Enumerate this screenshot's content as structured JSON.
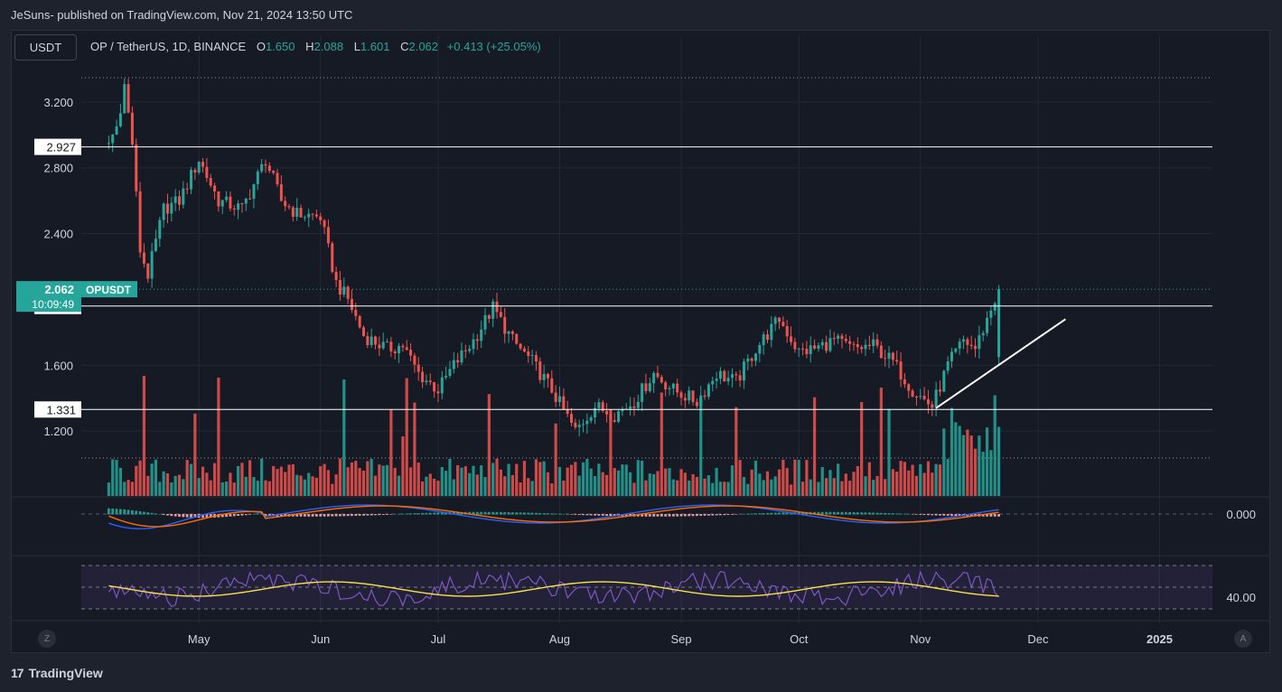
{
  "header": {
    "published": "JeSuns- published on TradingView.com, Nov 21, 2024 13:50 UTC"
  },
  "currency_button": "USDT",
  "legend": {
    "symbol": "OP / TetherUS, 1D, BINANCE",
    "o_label": "O",
    "o_value": "1.650",
    "h_label": "H",
    "h_value": "2.088",
    "l_label": "L",
    "l_value": "1.601",
    "c_label": "C",
    "c_value": "2.062",
    "change": "+0.413 (+25.05%)"
  },
  "price_scale": {
    "ticks": [
      "3.200",
      "2.800",
      "2.400",
      "1.600",
      "1.200"
    ],
    "tick_values": [
      3.2,
      2.8,
      2.4,
      1.6,
      1.2
    ],
    "range": [
      0.8,
      3.6
    ]
  },
  "price_lines": [
    {
      "label": "2.927",
      "value": 2.927
    },
    {
      "label": "1.960",
      "value": 1.96
    },
    {
      "label": "1.331",
      "value": 1.331
    }
  ],
  "last_price": {
    "value_label": "2.062",
    "countdown": "10:09:49",
    "symbol_tag": "OPUSDT",
    "value": 2.062
  },
  "macd_scale": {
    "label": "0.000"
  },
  "rsi_scale": {
    "label": "40.00"
  },
  "time_axis": {
    "labels": [
      "May",
      "Jun",
      "Jul",
      "Aug",
      "Sep",
      "Oct",
      "Nov",
      "Dec",
      "2025"
    ]
  },
  "corner_buttons": {
    "left": "Z",
    "right": "A"
  },
  "footer": {
    "brand": "TradingView",
    "logo_glyph": "17"
  },
  "colors": {
    "up": "#26a69a",
    "down": "#ef5350",
    "background": "#161a25",
    "macd": "#2962ff",
    "signal": "#ff6d00",
    "rsi": "#7e57c2",
    "rsi_ma": "#f7e14b"
  },
  "chart_data": {
    "type": "candlestick",
    "title": "OP / TetherUS, 1D, BINANCE",
    "x": [
      "2024-04-08",
      "2024-04-10",
      "2024-04-12",
      "2024-04-14",
      "2024-04-16",
      "2024-04-18",
      "2024-04-22",
      "2024-04-26",
      "2024-05-01",
      "2024-05-06",
      "2024-05-12",
      "2024-05-18",
      "2024-05-22",
      "2024-05-26",
      "2024-06-01",
      "2024-06-05",
      "2024-06-08",
      "2024-06-12",
      "2024-06-18",
      "2024-06-22",
      "2024-06-26",
      "2024-07-01",
      "2024-07-05",
      "2024-07-10",
      "2024-07-15",
      "2024-07-20",
      "2024-07-25",
      "2024-07-30",
      "2024-08-05",
      "2024-08-10",
      "2024-08-15",
      "2024-08-20",
      "2024-08-25",
      "2024-08-30",
      "2024-09-05",
      "2024-09-10",
      "2024-09-15",
      "2024-09-20",
      "2024-09-26",
      "2024-10-01",
      "2024-10-05",
      "2024-10-10",
      "2024-10-15",
      "2024-10-20",
      "2024-10-25",
      "2024-10-30",
      "2024-11-04",
      "2024-11-08",
      "2024-11-12",
      "2024-11-15",
      "2024-11-18",
      "2024-11-21"
    ],
    "close": [
      2.95,
      3.05,
      3.3,
      2.95,
      2.3,
      2.15,
      2.55,
      2.6,
      2.85,
      2.6,
      2.55,
      2.85,
      2.6,
      2.52,
      2.5,
      2.1,
      2.0,
      1.78,
      1.7,
      1.72,
      1.55,
      1.45,
      1.6,
      1.75,
      1.95,
      1.75,
      1.62,
      1.45,
      1.2,
      1.35,
      1.3,
      1.38,
      1.55,
      1.45,
      1.38,
      1.55,
      1.5,
      1.7,
      1.88,
      1.68,
      1.7,
      1.75,
      1.7,
      1.72,
      1.62,
      1.45,
      1.35,
      1.6,
      1.75,
      1.7,
      1.88,
      2.062
    ],
    "ylim": [
      0.8,
      3.6
    ],
    "horizontal_lines": [
      2.927,
      1.96,
      1.331
    ],
    "trendline": [
      {
        "x": "2024-11-05",
        "y": 1.34
      },
      {
        "x": "2024-12-08",
        "y": 1.88
      }
    ],
    "indicators": [
      "Volume",
      "MACD",
      "RSI"
    ]
  }
}
